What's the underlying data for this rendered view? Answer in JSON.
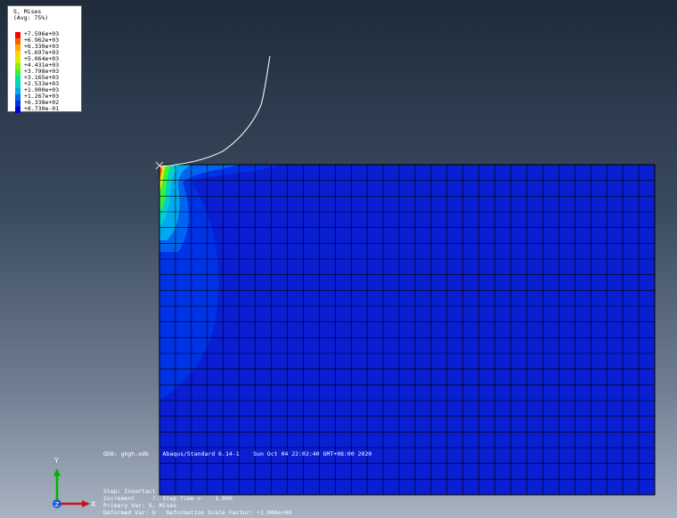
{
  "legend": {
    "title": "S, Mises",
    "subtitle": "(Avg: 75%)",
    "entries": [
      {
        "value": "+7.596e+03",
        "color": "#ff0000"
      },
      {
        "value": "+6.962e+03",
        "color": "#ff5a00"
      },
      {
        "value": "+6.330e+03",
        "color": "#ffa500"
      },
      {
        "value": "+5.697e+03",
        "color": "#ffd700"
      },
      {
        "value": "+5.064e+03",
        "color": "#d8f000"
      },
      {
        "value": "+4.431e+03",
        "color": "#8cf000"
      },
      {
        "value": "+3.798e+03",
        "color": "#3cf03c"
      },
      {
        "value": "+3.165e+03",
        "color": "#00e68c"
      },
      {
        "value": "+2.533e+03",
        "color": "#00d2c8"
      },
      {
        "value": "+1.900e+03",
        "color": "#00aaf0"
      },
      {
        "value": "+1.267e+03",
        "color": "#0064f0"
      },
      {
        "value": "+6.338e+02",
        "color": "#0032e6"
      },
      {
        "value": "+8.730e-01",
        "color": "#0000c8"
      }
    ]
  },
  "info": {
    "odb_line": "ODB: ghgh.odb    Abaqus/Standard 6.14-1    Sun Oct 04 22:02:40 GMT+08:00 2020",
    "step_line": "Step: Insertact",
    "increment_line": "Increment     7: Step Time =    1.000",
    "primary_line": "Primary Var: S, Mises",
    "deformed_line": "Deformed Var: U   Deformation Scale Factor: +1.000e+00"
  },
  "triad": {
    "y_label": "Y",
    "x_label": "X",
    "z_label": "Z",
    "y_color": "#00b400",
    "x_color": "#c81414",
    "z_color": "#1e5ad2"
  },
  "model": {
    "mesh_cols": 31,
    "mesh_rows": 21,
    "base_color": "#0a1ed2",
    "mesh_line_color": "#000000",
    "indenter_color": "#e6e6e6"
  }
}
